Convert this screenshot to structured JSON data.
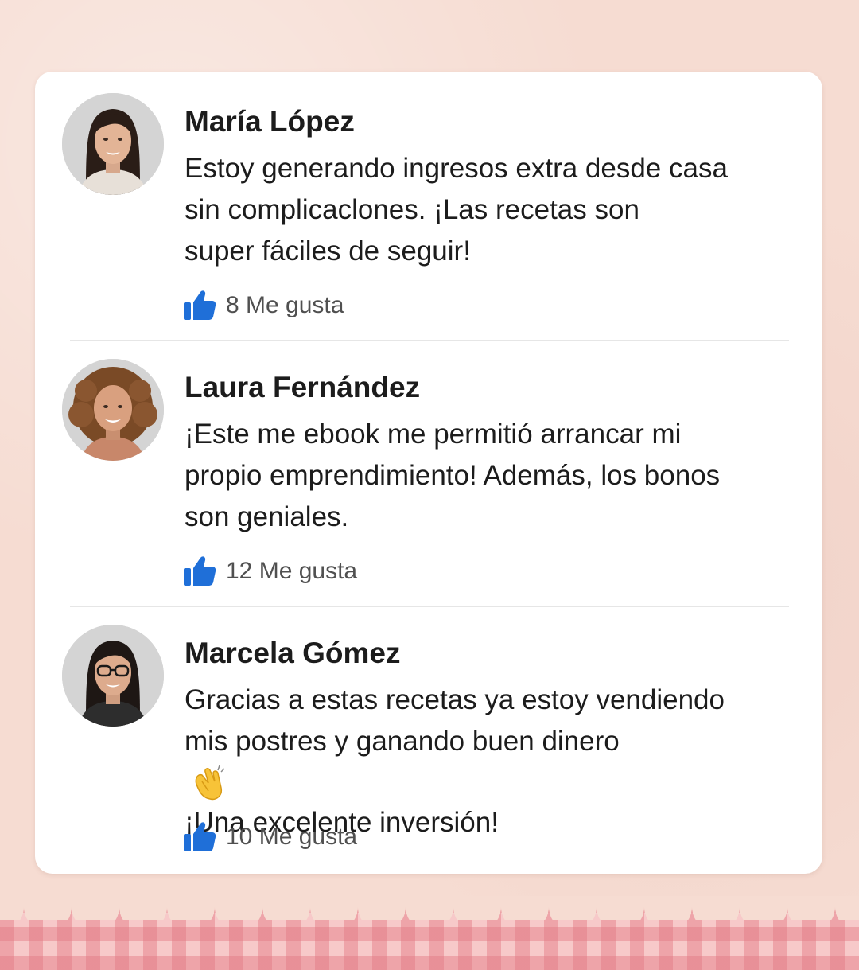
{
  "comments": [
    {
      "name": "María López",
      "lines": [
        "Estoy generando ingresos extra desde casa",
        "sin complicaclones. ¡Las recetas son",
        "super fáciles de seguir!"
      ],
      "likes": "8 Me gusta",
      "avatar_icon": "woman-portrait"
    },
    {
      "name": "Laura Fernández",
      "lines": [
        "¡Este me ebook me permitió arrancar mi",
        "propio emprendimiento! Además, los bonos",
        "son geniales."
      ],
      "likes": "12 Me gusta",
      "avatar_icon": "woman-curly-hair-portrait"
    },
    {
      "name": "Marcela Gómez",
      "lines": [
        "Gracias a estas recetas ya estoy vendiendo",
        "mis postres y ganando buen dinero",
        "¡Una excelente inversión!"
      ],
      "likes": "10 Me gusta",
      "avatar_icon": "woman-glasses-portrait",
      "emoji": "clapping-hands-icon"
    }
  ],
  "colors": {
    "like_blue": "#1f6fd8",
    "background": "#f6dcd2",
    "gingham": "#f7c9c9"
  }
}
